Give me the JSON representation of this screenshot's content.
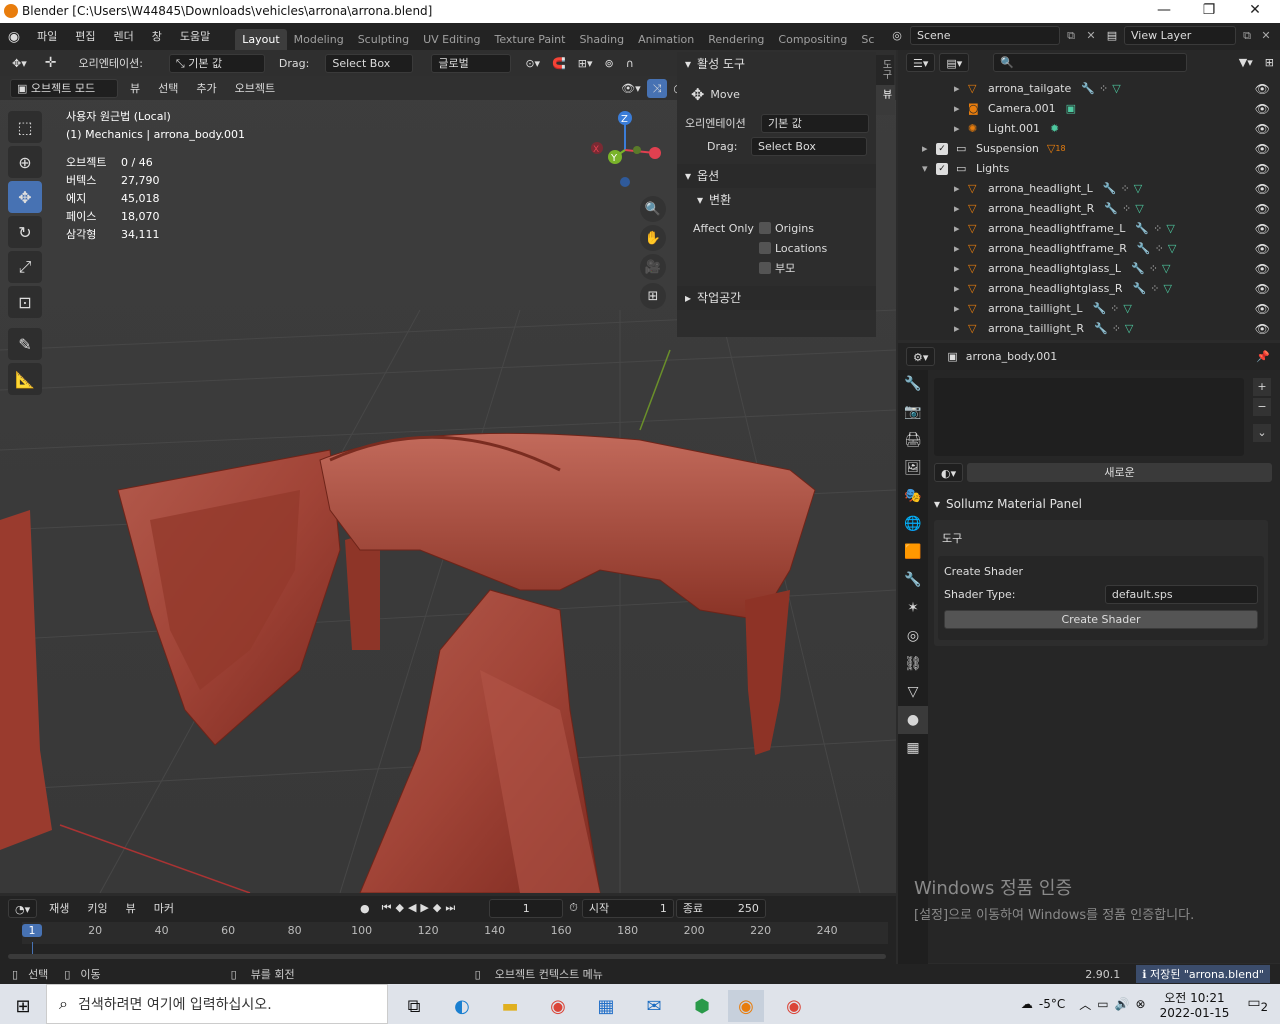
{
  "window": {
    "title": "Blender [C:\\Users\\W44845\\Downloads\\vehicles\\arrona\\arrona.blend]",
    "minimize": "—",
    "maximize": "❐",
    "close": "✕"
  },
  "menu": [
    "파일",
    "편집",
    "렌더",
    "창",
    "도움말"
  ],
  "workspaces": [
    "Layout",
    "Modeling",
    "Sculpting",
    "UV Editing",
    "Texture Paint",
    "Shading",
    "Animation",
    "Rendering",
    "Compositing",
    "Sc"
  ],
  "scene": {
    "label": "Scene",
    "view_layer": "View Layer"
  },
  "tool_header": {
    "orientation_label": "오리엔테이션:",
    "orientation_value": "기본 값",
    "drag_label": "Drag:",
    "drag_value": "Select Box",
    "transform_space": "글로벌",
    "options": "옵션"
  },
  "vp_header": {
    "mode": "오브젝트 모드",
    "items": [
      "뷰",
      "선택",
      "추가",
      "오브젝트"
    ]
  },
  "stats": {
    "line1": "사용자 원근법 (Local)",
    "line2": "(1) Mechanics | arrona_body.001",
    "rows": [
      {
        "k": "오브젝트",
        "v": "0 / 46"
      },
      {
        "k": "버텍스",
        "v": "27,790"
      },
      {
        "k": "에지",
        "v": "45,018"
      },
      {
        "k": "페이스",
        "v": "18,070"
      },
      {
        "k": "삼각형",
        "v": "34,111"
      }
    ]
  },
  "npanel": {
    "active_tool": "활성 도구",
    "move": "Move",
    "orientation_label": "오리엔테이션",
    "orientation_value": "기본 값",
    "drag_label": "Drag:",
    "drag_value": "Select Box",
    "options": "옵션",
    "transform": "변환",
    "affect_only": "Affect Only",
    "origins": "Origins",
    "locations": "Locations",
    "parents": "부모",
    "workspace": "작업공간",
    "tabs": [
      "도구",
      "뷰"
    ]
  },
  "timeline": {
    "menu": [
      "재생",
      "키잉",
      "뷰",
      "마커"
    ],
    "frame": "1",
    "start_label": "시작",
    "start": "1",
    "end_label": "종료",
    "end": "250",
    "ticks": [
      "1",
      "20",
      "40",
      "60",
      "80",
      "100",
      "120",
      "140",
      "160",
      "180",
      "200",
      "220",
      "240"
    ]
  },
  "outliner": {
    "rows": [
      {
        "name": "arrona_tailgate",
        "type": "mesh",
        "indent": 3
      },
      {
        "name": "Camera.001",
        "type": "camera",
        "indent": 3
      },
      {
        "name": "Light.001",
        "type": "light",
        "indent": 3
      },
      {
        "name": "Suspension",
        "type": "collection",
        "indent": 1,
        "badge": "18"
      },
      {
        "name": "Lights",
        "type": "collection",
        "indent": 1
      },
      {
        "name": "arrona_headlight_L",
        "type": "mesh",
        "indent": 3
      },
      {
        "name": "arrona_headlight_R",
        "type": "mesh",
        "indent": 3
      },
      {
        "name": "arrona_headlightframe_L",
        "type": "mesh",
        "indent": 3
      },
      {
        "name": "arrona_headlightframe_R",
        "type": "mesh",
        "indent": 3
      },
      {
        "name": "arrona_headlightglass_L",
        "type": "mesh",
        "indent": 3
      },
      {
        "name": "arrona_headlightglass_R",
        "type": "mesh",
        "indent": 3
      },
      {
        "name": "arrona_taillight_L",
        "type": "mesh",
        "indent": 3
      },
      {
        "name": "arrona_taillight_R",
        "type": "mesh",
        "indent": 3
      }
    ]
  },
  "properties": {
    "object": "arrona_body.001",
    "new_button": "새로운",
    "panel": "Sollumz Material Panel",
    "tools": "도구",
    "create_shader": "Create Shader",
    "shader_type_label": "Shader Type:",
    "shader_type": "default.sps",
    "create_button": "Create Shader"
  },
  "watermark": {
    "title": "Windows 정품 인증",
    "desc": "[설정]으로 이동하여 Windows를 정품 인증합니다."
  },
  "status": {
    "select": "선택",
    "move": "이동",
    "rotate": "뷰를 회전",
    "context": "오브젝트 컨텍스트 메뉴",
    "version": "2.90.1",
    "saved": "저장된 \"arrona.blend\""
  },
  "taskbar": {
    "search": "검색하려면 여기에 입력하십시오.",
    "weather": "-5°C",
    "time": "오전 10:21",
    "date": "2022-01-15",
    "notif": "2"
  },
  "colors": {
    "accent": "#4772b3",
    "mesh": "#e87d0d",
    "collection": "#ffffff",
    "data": "#4ec9a0"
  }
}
